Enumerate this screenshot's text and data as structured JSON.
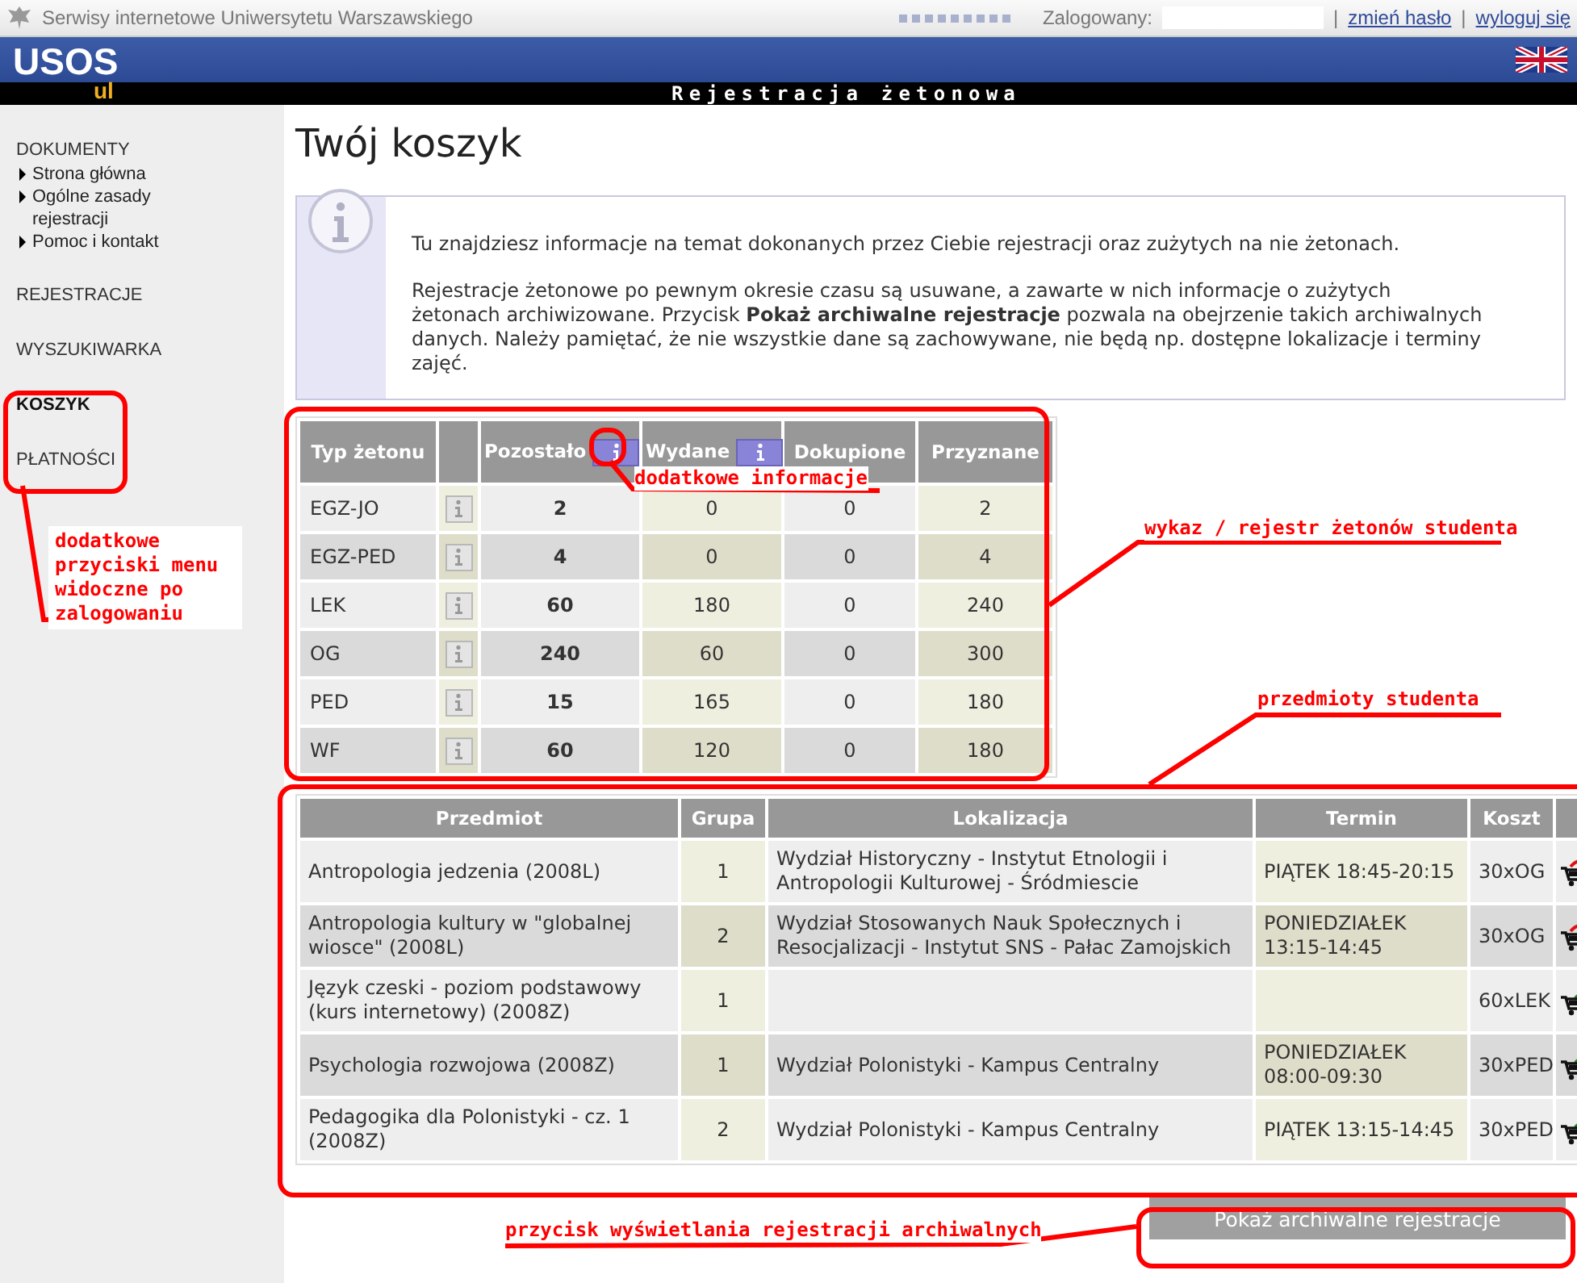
{
  "top_bar": {
    "site": "Serwisy internetowe Uniwersytetu Warszawskiego",
    "logged_in_label": "Zalogowany:",
    "links": [
      {
        "separator": "|",
        "label": "zmień hasło"
      },
      {
        "separator": "|",
        "label": "wyloguj się"
      }
    ]
  },
  "header": {
    "logo": "USOS",
    "logo_sub": "ul",
    "section_title": "Rejestracja żetonowa"
  },
  "sidebar": {
    "sections": [
      {
        "label": "DOKUMENTY",
        "selected": false,
        "children": [
          {
            "label": "Strona główna"
          },
          {
            "label": "Ogólne zasady rejestracji"
          },
          {
            "label": "Pomoc i kontakt"
          }
        ]
      },
      {
        "label": "REJESTRACJE",
        "selected": false
      },
      {
        "label": "WYSZUKIWARKA",
        "selected": false
      },
      {
        "label": "KOSZYK",
        "selected": true
      },
      {
        "label": "PŁATNOŚCI",
        "selected": false
      }
    ]
  },
  "page_title": "Twój koszyk",
  "info_box": {
    "paragraphs": [
      "Tu znajdziesz informacje na temat dokonanych przez Ciebie rejestracji oraz zużytych na nie żetonach.",
      "Rejestracje żetonowe po pewnym okresie czasu są usuwane, a zawarte w nich informacje o zużytych żetonach archiwizowane. Przycisk **Pokaż archiwalne rejestracje** pozwala na obejrzenie takich archiwalnych danych. Należy pamiętać, że nie wszystkie dane są zachowywane, nie będą np. dostępne lokalizacje i terminy zajęć."
    ]
  },
  "token_table": {
    "columns": [
      {
        "label": "Typ żetonu",
        "info": false
      },
      {
        "info": false
      },
      {
        "label": "Pozostało",
        "info": true
      },
      {
        "label": "Wydane",
        "info": true
      },
      {
        "label": "Dokupione",
        "info": false
      },
      {
        "label": "Przyznane",
        "info": false
      }
    ],
    "rows": [
      {
        "type": "EGZ-JO",
        "remaining": "2",
        "spent": "0",
        "bought": "0",
        "granted": "2"
      },
      {
        "type": "EGZ-PED",
        "remaining": "4",
        "spent": "0",
        "bought": "0",
        "granted": "4"
      },
      {
        "type": "LEK",
        "remaining": "60",
        "spent": "180",
        "bought": "0",
        "granted": "240"
      },
      {
        "type": "OG",
        "remaining": "240",
        "spent": "60",
        "bought": "0",
        "granted": "300"
      },
      {
        "type": "PED",
        "remaining": "15",
        "spent": "165",
        "bought": "0",
        "granted": "180"
      },
      {
        "type": "WF",
        "remaining": "60",
        "spent": "120",
        "bought": "0",
        "granted": "180"
      }
    ]
  },
  "course_table": {
    "columns": [
      "Przedmiot",
      "Grupa",
      "Lokalizacja",
      "Termin",
      "Koszt"
    ],
    "rows": [
      {
        "course": "Antropologia jedzenia (2008L)",
        "group": "1",
        "location": "Wydział Historyczny - Instytut Etnologii i Antropologii Kulturowej - Śródmiescie",
        "term": "PIĄTEK 18:45-20:15",
        "cost": "30xOG",
        "kind": "unregister"
      },
      {
        "course": "Antropologia kultury w \"globalnej wiosce\" (2008L)",
        "group": "2",
        "location": "Wydział Stosowanych Nauk Społecznych i Resocjalizacji - Instytut SNS - Pałac Zamojskich",
        "term": "PONIEDZIAŁEK 13:15-14:45",
        "cost": "30xOG",
        "kind": "unregister"
      },
      {
        "course": "Język czeski - poziom podstawowy (kurs internetowy) (2008Z)",
        "group": "1",
        "cost": "60xLEK",
        "kind": "registered"
      },
      {
        "course": "Psychologia rozwojowa (2008Z)",
        "group": "1",
        "location": "Wydział Polonistyki - Kampus Centralny",
        "term": "PONIEDZIAŁEK 08:00-09:30",
        "cost": "30xPED",
        "kind": "registered"
      },
      {
        "course": "Pedagogika dla Polonistyki - cz. 1 (2008Z)",
        "group": "2",
        "location": "Wydział Polonistyki - Kampus Centralny",
        "term": "PIĄTEK 13:15-14:45",
        "cost": "30xPED",
        "kind": "registered"
      }
    ]
  },
  "archive_button": "Pokaż archiwalne rejestracje",
  "annotations": [
    {
      "text": "dodatkowe przyciski menu widoczne po zalogowaniu"
    },
    {
      "text": "dodatkowe informacje"
    },
    {
      "text": "wykaz / rejestr żetonów studenta"
    },
    {
      "text": "przedmioty studenta"
    },
    {
      "text": "przycisk wyświetlania rejestracji archiwalnych"
    }
  ]
}
